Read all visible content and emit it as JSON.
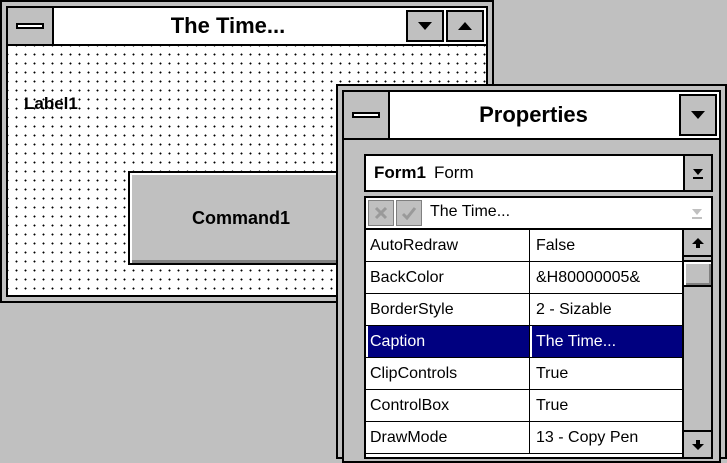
{
  "form_window": {
    "title": "The Time...",
    "label1": "Label1",
    "command1": "Command1"
  },
  "properties_window": {
    "title": "Properties",
    "object_name": "Form1",
    "object_type": "Form",
    "edit_value": "The Time...",
    "properties": [
      {
        "name": "AutoRedraw",
        "value": "False",
        "selected": false
      },
      {
        "name": "BackColor",
        "value": "&H80000005&",
        "selected": false
      },
      {
        "name": "BorderStyle",
        "value": "2 - Sizable",
        "selected": false
      },
      {
        "name": "Caption",
        "value": "The Time...",
        "selected": true
      },
      {
        "name": "ClipControls",
        "value": "True",
        "selected": false
      },
      {
        "name": "ControlBox",
        "value": "True",
        "selected": false
      },
      {
        "name": "DrawMode",
        "value": "13 - Copy Pen",
        "selected": false
      }
    ],
    "selection_color": "#000080"
  },
  "icons": [
    "system-menu-icon",
    "minimize-icon",
    "maximize-icon",
    "dropdown-arrow-icon",
    "cancel-x-icon",
    "checkmark-icon",
    "scroll-up-icon",
    "scroll-down-icon"
  ]
}
